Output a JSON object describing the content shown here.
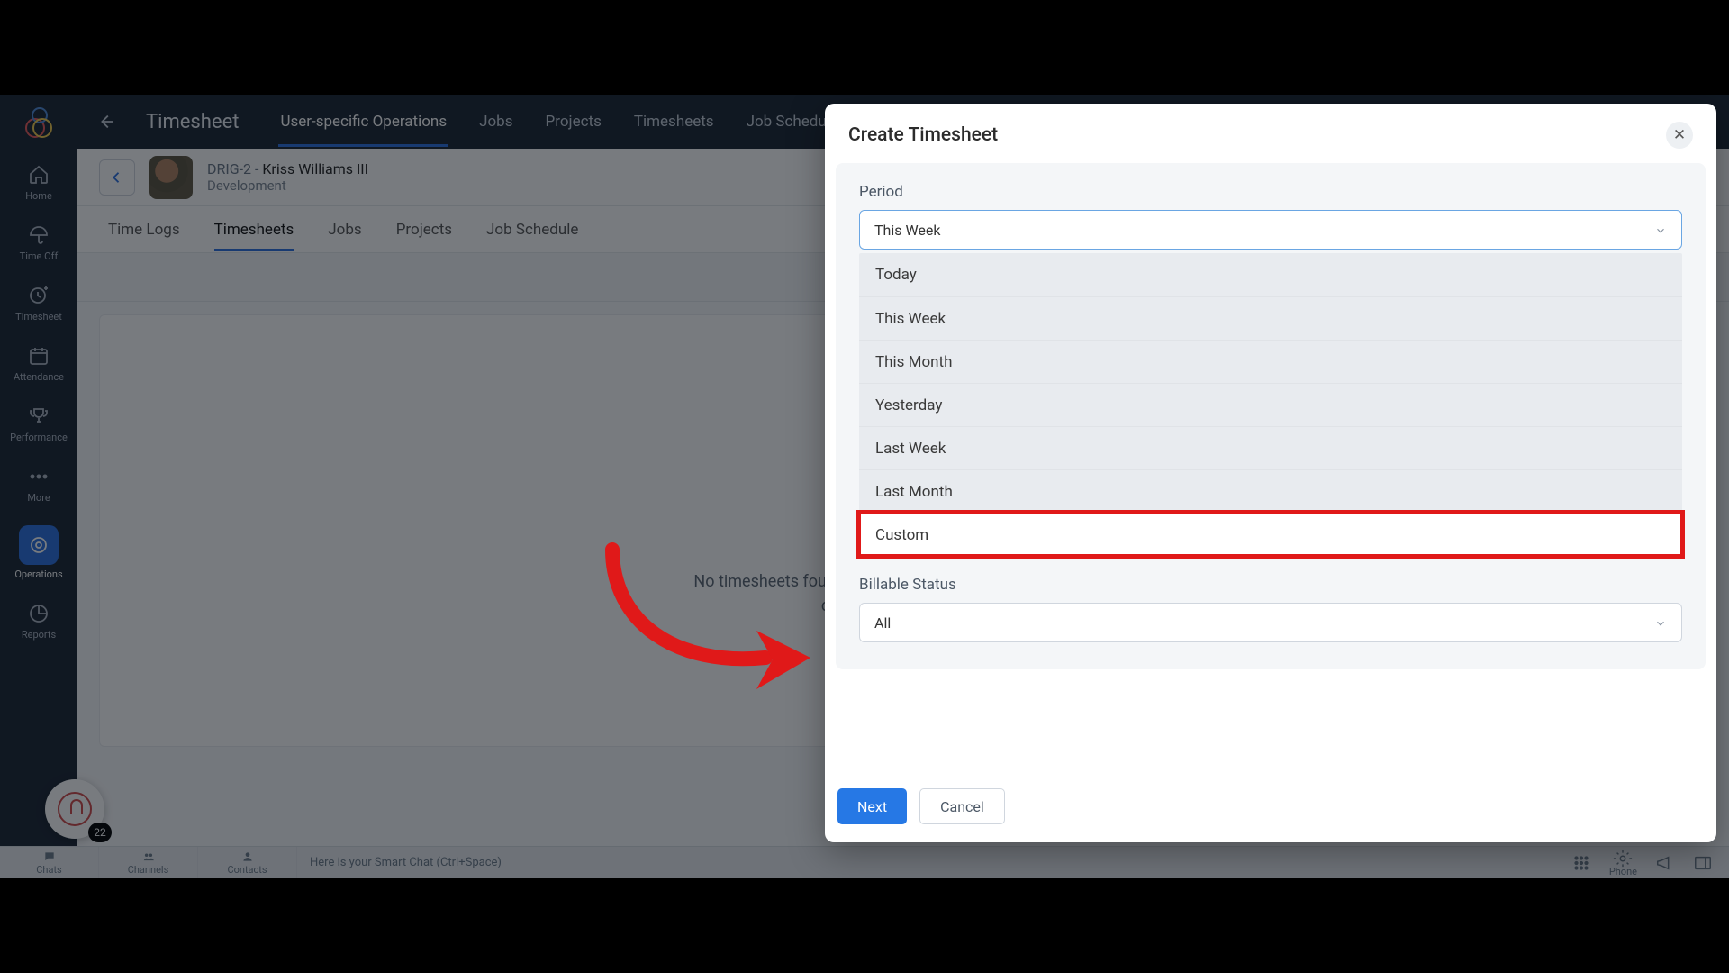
{
  "topbar": {
    "module_title": "Timesheet",
    "tabs": {
      "user_ops": "User-specific Operations",
      "jobs": "Jobs",
      "projects": "Projects",
      "timesheets": "Timesheets",
      "job_schedule": "Job Schedule"
    }
  },
  "rail": {
    "home": "Home",
    "timeoff": "Time Off",
    "timesheet": "Timesheet",
    "attendance": "Attendance",
    "performance": "Performance",
    "more": "More",
    "operations": "Operations",
    "reports": "Reports"
  },
  "user": {
    "id_prefix": "DRIG-2 - ",
    "name": "Kriss Williams III",
    "dept": "Development"
  },
  "innertabs": {
    "time_logs": "Time Logs",
    "timesheets": "Timesheets",
    "jobs": "Jobs",
    "projects": "Projects",
    "job_schedule": "Job Schedule"
  },
  "empty": {
    "line1": "No timesheets found for the period. To create a timesheet,",
    "line2": "click Create Timesheet"
  },
  "chatbar": {
    "chats": "Chats",
    "channels": "Channels",
    "contacts": "Contacts",
    "smart": "Here is your Smart Chat (Ctrl+Space)",
    "phone": "Phone"
  },
  "help_badge": "22",
  "modal": {
    "title": "Create Timesheet",
    "period_label": "Period",
    "period_value": "This Week",
    "options": {
      "today": "Today",
      "this_week": "This Week",
      "this_month": "This Month",
      "yesterday": "Yesterday",
      "last_week": "Last Week",
      "last_month": "Last Month",
      "custom": "Custom"
    },
    "billable_label": "Billable Status",
    "billable_value": "All",
    "next": "Next",
    "cancel": "Cancel"
  }
}
